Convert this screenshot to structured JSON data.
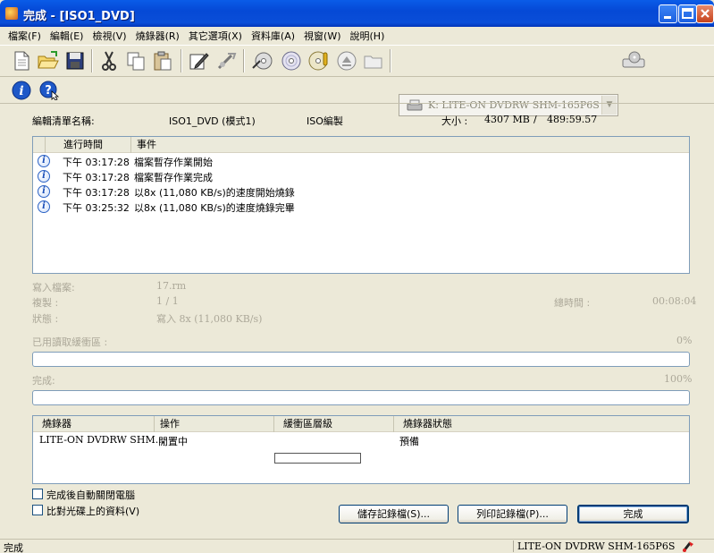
{
  "window": {
    "title": "完成 - [ISO1_DVD]"
  },
  "menu": [
    "檔案(F)",
    "編輯(E)",
    "檢視(V)",
    "燒錄器(R)",
    "其它選項(X)",
    "資料庫(A)",
    "視窗(W)",
    "說明(H)"
  ],
  "toolbar": {
    "drive": "K: LITE-ON  DVDRW SHM-165P6S"
  },
  "summary": {
    "name_label": "編輯清單名稱:",
    "name_value": "ISO1_DVD (模式1)",
    "type_value": "ISO編製",
    "size_label": "大小 :",
    "size_value": "4307 MB",
    "size_sep": "/",
    "time_value": "489:59.57"
  },
  "log": {
    "columns": [
      "進行時間",
      "事件"
    ],
    "rows": [
      {
        "time": "下午 03:17:28",
        "event": "檔案暫存作業開始"
      },
      {
        "time": "下午 03:17:28",
        "event": "檔案暫存作業完成"
      },
      {
        "time": "下午 03:17:28",
        "event": "以8x (11,080 KB/s)的速度開始燒錄"
      },
      {
        "time": "下午 03:25:32",
        "event": "以8x (11,080 KB/s)的速度燒錄完畢"
      }
    ]
  },
  "progress": {
    "write_file_label": "寫入檔案:",
    "write_file_value": "17.rm",
    "copy_label": "複製 :",
    "copy_value": "1 / 1",
    "status_label": "狀態 :",
    "status_value": "寫入 8x (11,080 KB/s)",
    "total_time_label": "總時間 :",
    "total_time_value": "00:08:04",
    "buffer_label": "已用讀取緩衝區 :",
    "buffer_percent": "0%",
    "buffer_level": 0,
    "done_label": "完成:",
    "done_percent": "100%",
    "done_level": 100
  },
  "recorders": {
    "columns": [
      "燒錄器",
      "操作",
      "緩衝區層級",
      "燒錄器狀態"
    ],
    "rows": [
      {
        "recorder": "LITE-ON DVDRW SHM...",
        "action": "閒置中",
        "buffer_level": 0,
        "state": "預備"
      }
    ]
  },
  "options": {
    "shutdown_label": "完成後自動關閉電腦",
    "verify_label": "比對光碟上的資料(V)"
  },
  "buttons": {
    "save_log": "儲存記錄檔(S)...",
    "print_log": "列印記錄檔(P)...",
    "done": "完成"
  },
  "status": {
    "left": "完成",
    "drive": "LITE-ON  DVDRW SHM-165P6S"
  },
  "colors": {
    "titlebar": "#0549d6",
    "face": "#ece9d8",
    "border_blue": "#7f9db9",
    "info_blue": "#2b62c4"
  }
}
